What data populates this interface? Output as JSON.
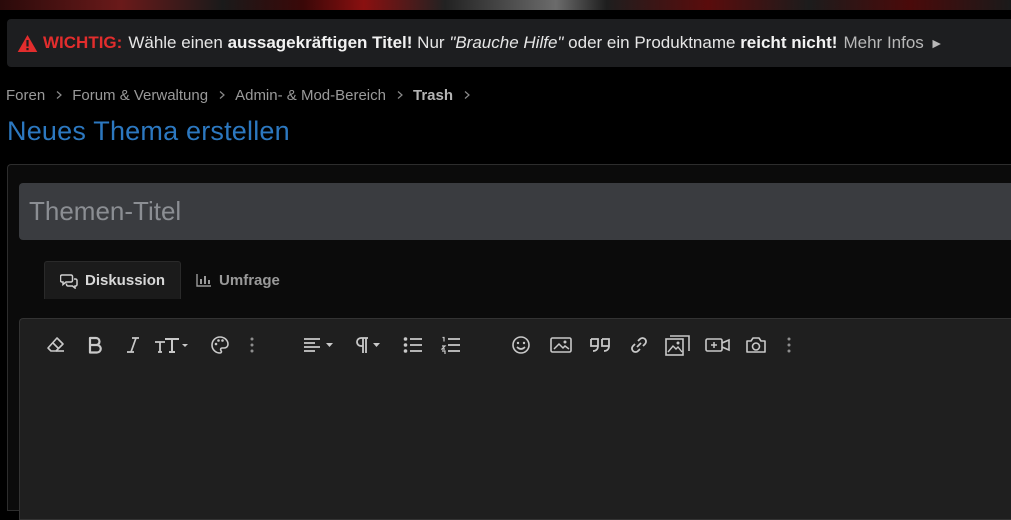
{
  "notice": {
    "label": "WICHTIG:",
    "text_1": "Wähle einen",
    "text_2": "aussagekräftigen Titel!",
    "text_3": "Nur",
    "text_4": "\"Brauche Hilfe\"",
    "text_5": "oder ein Produktname",
    "text_6": "reicht nicht!",
    "more": "Mehr Infos",
    "more_arrow": "►",
    "accent_color": "#e22d2d"
  },
  "breadcrumb": {
    "items": [
      "Foren",
      "Forum & Verwaltung",
      "Admin- & Mod-Bereich",
      "Trash"
    ]
  },
  "page": {
    "title": "Neues Thema erstellen",
    "title_color": "#2c78c0"
  },
  "form": {
    "title_placeholder": "Themen-Titel",
    "tabs": [
      {
        "label": "Diskussion",
        "icon": "discussion-icon",
        "active": true
      },
      {
        "label": "Umfrage",
        "icon": "poll-chart-icon",
        "active": false
      }
    ],
    "toolbar_icons": [
      "remove-format-icon",
      "bold-icon",
      "italic-icon",
      "text-size-icon",
      "color-palette-icon",
      "more-vertical-icon",
      "align-icon",
      "paragraph-icon",
      "bullet-list-icon",
      "numbered-list-icon",
      "emoji-icon",
      "image-icon",
      "quote-icon",
      "link-icon",
      "media-gallery-icon",
      "video-icon",
      "screenshot-icon",
      "more-vertical-icon"
    ]
  }
}
